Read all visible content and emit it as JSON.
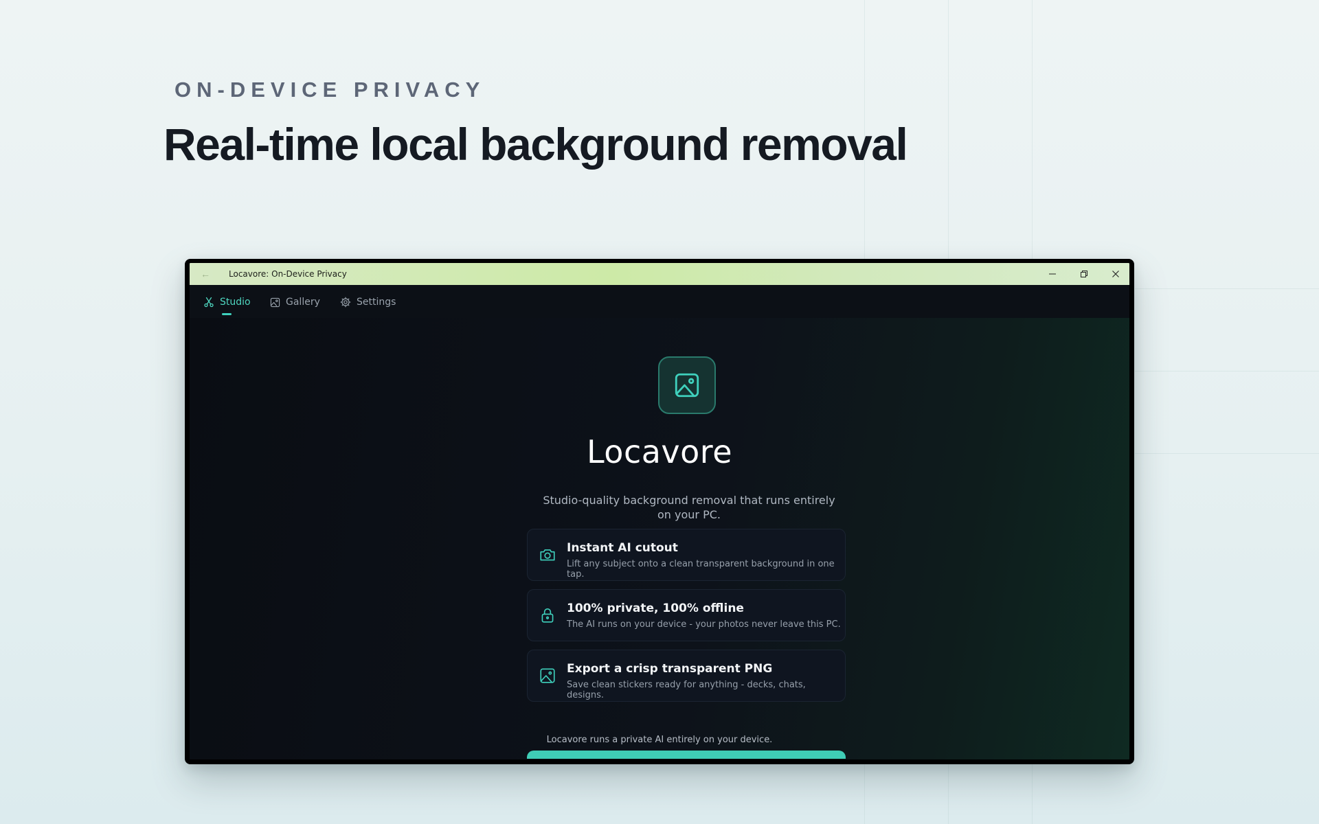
{
  "page": {
    "eyebrow": "ON-DEVICE PRIVACY",
    "headline": "Real-time local background removal"
  },
  "window": {
    "title": "Locavore: On-Device Privacy",
    "titlebar_buttons": [
      "minimize-icon",
      "restore-icon",
      "close-icon"
    ]
  },
  "nav": {
    "tabs": [
      {
        "label": "Studio",
        "icon": "scissors-icon",
        "active": true
      },
      {
        "label": "Gallery",
        "icon": "image-icon",
        "active": false
      },
      {
        "label": "Settings",
        "icon": "gear-icon",
        "active": false
      }
    ]
  },
  "hero": {
    "icon": "image-icon",
    "app_name": "Locavore",
    "tagline": "Studio-quality background removal that runs entirely on your PC."
  },
  "features": [
    {
      "icon": "camera-icon",
      "title": "Instant AI cutout",
      "description": "Lift any subject onto a clean transparent background in one tap."
    },
    {
      "icon": "lock-icon",
      "title": "100% private, 100% offline",
      "description": "The AI runs on your device - your photos never leave this PC."
    },
    {
      "icon": "image-icon",
      "title": "Export a crisp transparent PNG",
      "description": "Save clean stickers ready for anything - decks, chats, designs."
    }
  ],
  "footnote": "Locavore runs a private AI entirely on your device.",
  "colors": {
    "accent": "#3fd1bd",
    "window_bg": "#0b0f15",
    "titlebar": "#cdeaa7",
    "page_bg": "#e6f0f1"
  }
}
